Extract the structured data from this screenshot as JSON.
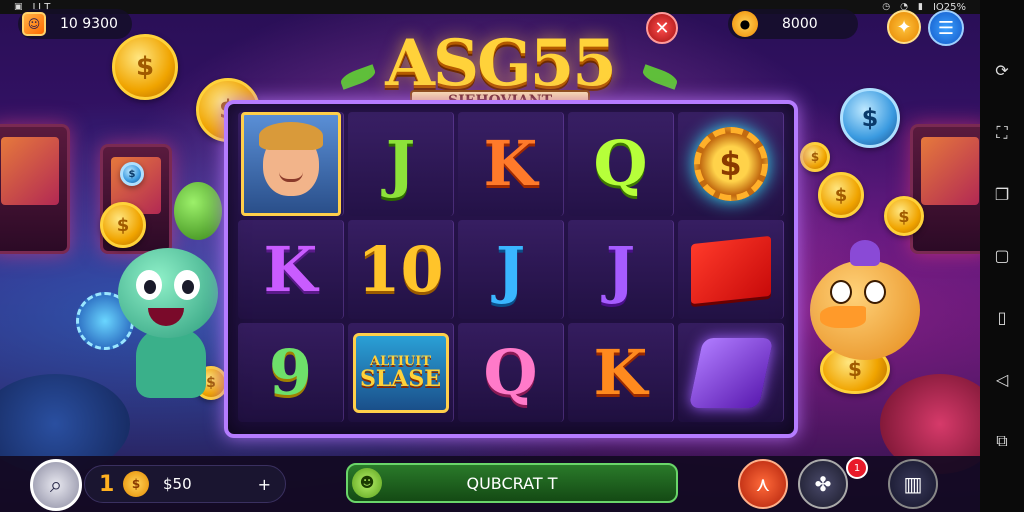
{
  "status_bar": {
    "left_text": "LI T",
    "right_text": "IO25%"
  },
  "top_bar": {
    "balance": "10 9300",
    "coins": "8000",
    "close_glyph": "✕",
    "plus_glyph": "✦",
    "menu_glyph": "☰"
  },
  "logo": {
    "title": "ASG55",
    "subtitle": "SIEHOVIANT"
  },
  "reels": {
    "row1": {
      "c2": "J",
      "c3": "K",
      "c4": "Q",
      "c5": "$"
    },
    "row2": {
      "c1": "K",
      "c2": "10",
      "c3": "J",
      "c4": "J"
    },
    "row3": {
      "c1": "9",
      "c2_line1": "ALTIUIT",
      "c2_line2": "SLASE",
      "c3": "Q",
      "c4": "K"
    }
  },
  "bottom_bar": {
    "bet_minus": "1",
    "bet_value": "$50",
    "bet_plus": "+",
    "spin_label": "QUBCRAT T",
    "notification_count": "1"
  },
  "colors": {
    "accent": "#ffd23a",
    "board_border": "#b57cff",
    "spin_green": "#2a7a2a"
  },
  "icons": [
    "search-icon",
    "coin-icon",
    "chick-icon",
    "close-icon",
    "plus-icon",
    "menu-icon",
    "smile-icon",
    "cards-icon",
    "share-icon",
    "stats-icon"
  ]
}
